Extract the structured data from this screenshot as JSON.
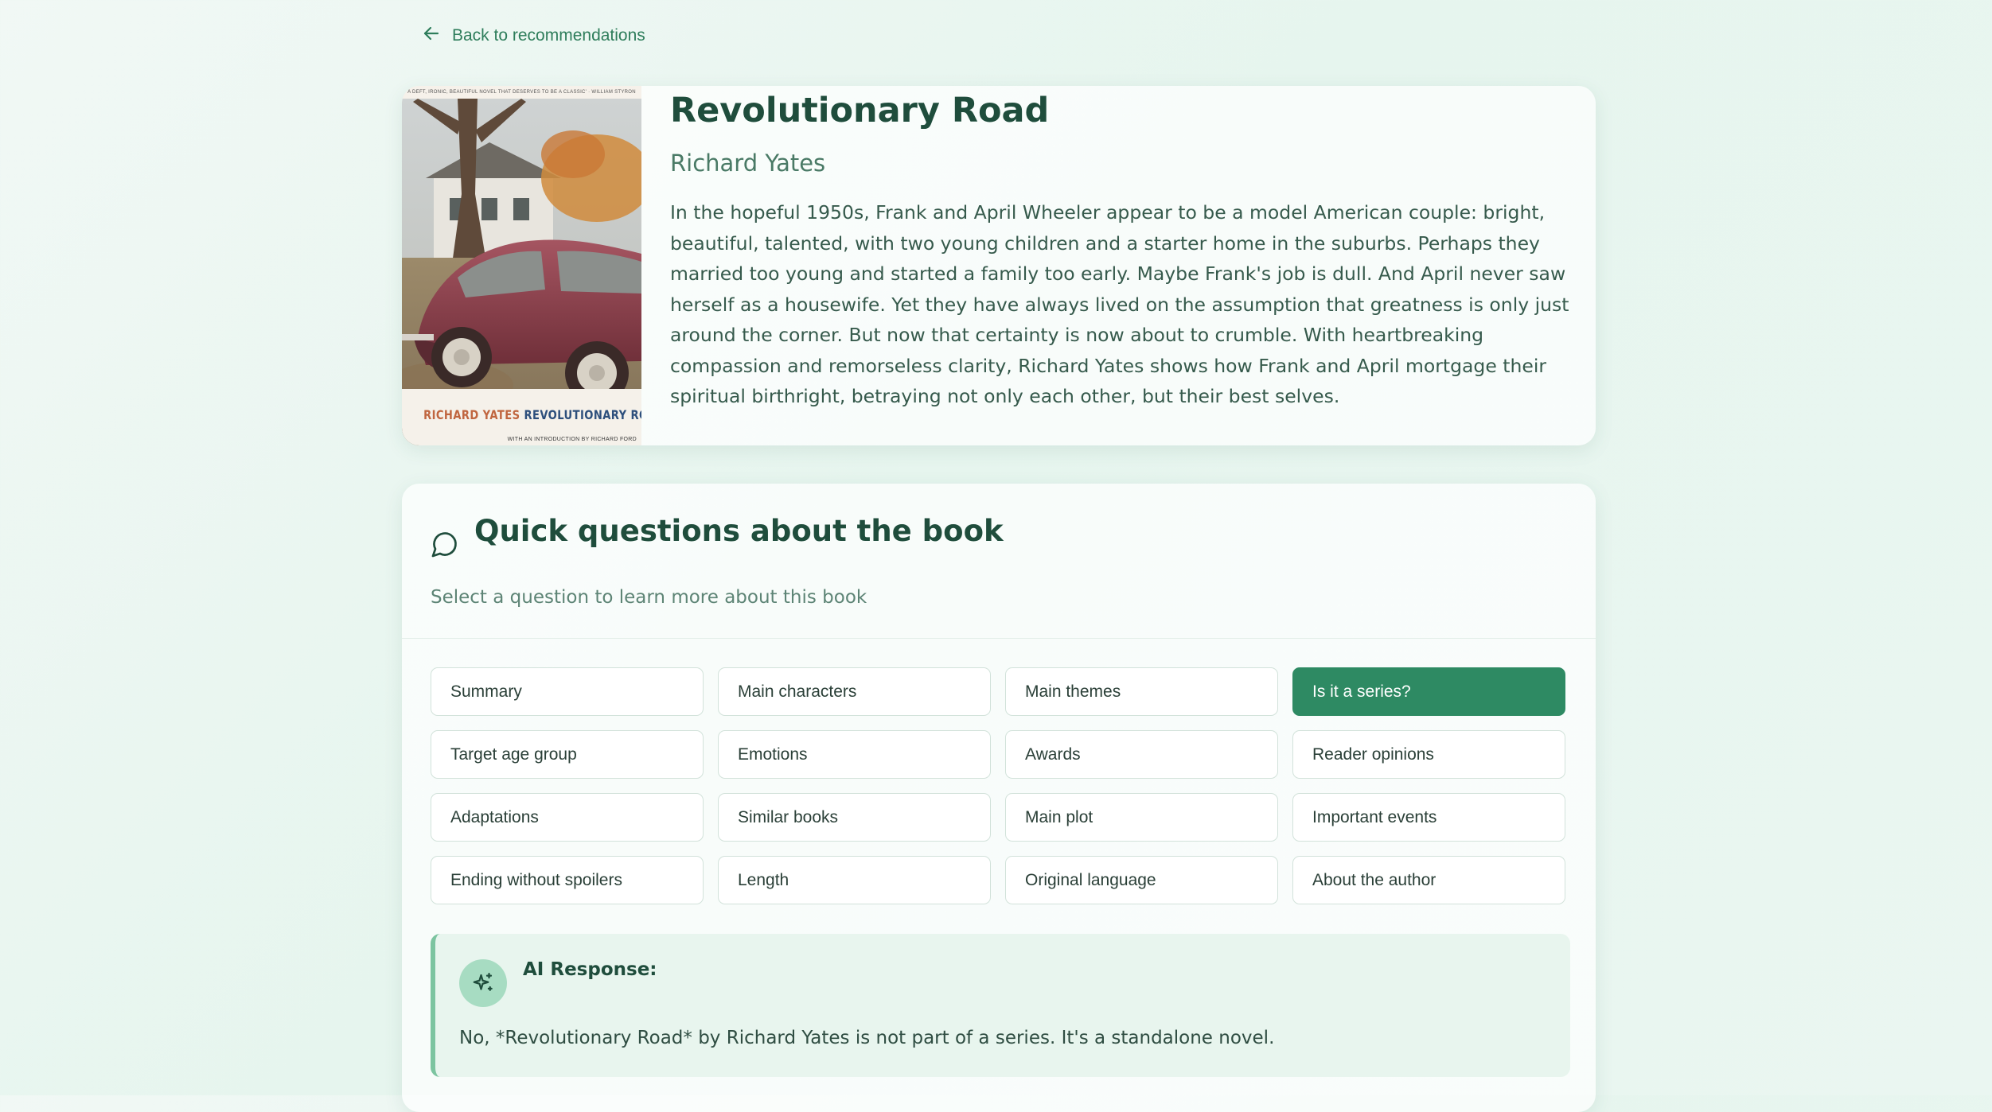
{
  "nav": {
    "back_label": "Back to recommendations"
  },
  "book": {
    "title": "Revolutionary Road",
    "author": "Richard Yates",
    "description": "In the hopeful 1950s, Frank and April Wheeler appear to be a model American couple: bright, beautiful, talented, with two young children and a starter home in the suburbs. Perhaps they married too young and started a family too early. Maybe Frank's job is dull. And April never saw herself as a housewife. Yet they have always lived on the assumption that greatness is only just around the corner. But now that certainty is now about to crumble. With heartbreaking compassion and remorseless clarity, Richard Yates shows how Frank and April mortgage their spiritual birthright, betraying not only each other, but their best selves.",
    "cover": {
      "tagline": "A DEFT, IRONIC, BEAUTIFUL NOVEL THAT DESERVES TO BE A CLASSIC' · WILLIAM STYRON",
      "author_text": "RICHARD YATES",
      "title_text": "REVOLUTIONARY ROAD",
      "intro_text": "WITH AN INTRODUCTION BY RICHARD FORD"
    }
  },
  "qa": {
    "title": "Quick questions about the book",
    "subtitle": "Select a question to learn more about this book",
    "questions": [
      "Summary",
      "Main characters",
      "Main themes",
      "Is it a series?",
      "Target age group",
      "Emotions",
      "Awards",
      "Reader opinions",
      "Adaptations",
      "Similar books",
      "Main plot",
      "Important events",
      "Ending without spoilers",
      "Length",
      "Original language",
      "About the author"
    ],
    "active_question": "Is it a series?",
    "response_label": "AI Response:",
    "response_text": "No, *Revolutionary Road* by Richard Yates is not part of a series. It's a standalone novel."
  },
  "colors": {
    "accent": "#2e8a63",
    "heading": "#1f4d3c",
    "response_bg": "#e8f5ee",
    "response_border": "#7cc4a0",
    "cover_author": "#c0653f",
    "cover_title": "#2d4f7c"
  },
  "icons": {
    "back": "arrow-left-icon",
    "chat": "chat-bubble-icon",
    "ai": "sparkles-icon"
  }
}
